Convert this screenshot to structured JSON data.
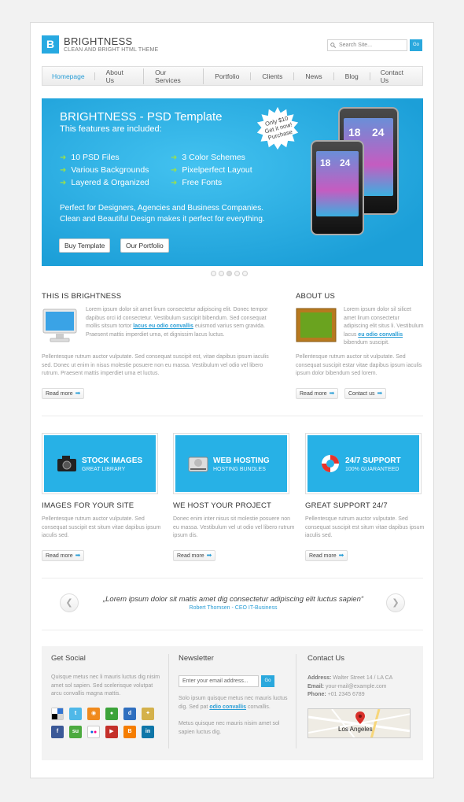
{
  "brand": {
    "logo_letter": "B",
    "title": "BRIGHTNESS",
    "subtitle": "CLEAN AND BRIGHT HTML THEME"
  },
  "search": {
    "placeholder": "Search Site...",
    "button": "Go"
  },
  "nav": [
    "Homepage",
    "About Us",
    "Our Services",
    "Portfolio",
    "Clients",
    "News",
    "Blog",
    "Contact Us"
  ],
  "slider": {
    "title": "BRIGHTNESS - PSD Template",
    "subtitle": "This features are included:",
    "features_left": [
      "10 PSD Files",
      "Various Backgrounds",
      "Layered & Organized"
    ],
    "features_right": [
      "3 Color Schemes",
      "Pixelperfect Layout",
      "Free Fonts"
    ],
    "desc1": "Perfect for Designers, Agencies and Business Companies.",
    "desc2": "Clean and Beautiful Design makes it perfect for everything.",
    "btn_buy": "Buy Template",
    "btn_portfolio": "Our Portfolio",
    "badge": [
      "Only $10",
      "Get it now!",
      "Purchase"
    ],
    "phone_time_a": "18",
    "phone_time_b": "24"
  },
  "intro": {
    "title": "THIS IS BRIGHTNESS",
    "p1a": "Lorem ipsum dolor sit amet lirum consectetur adipiscing elit. Donec tempor dapibus orci id consectetur. Vestibulum suscipit bibendum. Sed consequat mollis sitsum tortor",
    "p1link": "lacus eu odio convallis",
    "p1b": "euismod varius sem gravida. Praesent mattis imperdiet urna, et dignissim lacus luctus.",
    "p2": "Pellentesque rutrum auctor vulputate. Sed consequat suscipit est, vitae dapibus ipsum iaculis sed. Donec ut enim in nisus molestie posuere non eu massa. Vestibulum vel odio vel libero rutrum. Praesent mattis imperdiet urna et luctus.",
    "more": "Read more"
  },
  "about": {
    "title": "ABOUT US",
    "p1a": "Lorem ipsum dolor sil silicet amet lirum consectetur adipiscing elit situs li. Vestibulum lacus",
    "p1link": "eu odio convallis",
    "p1b": "bibendum suscipit.",
    "p2": "Pellentesque rutrum auctor sit vulputate. Sed consequat suscipit estar vitae dapibus ipsum iaculis ipsum dolor bibendum sed lorem.",
    "more": "Read more",
    "contact": "Contact us"
  },
  "boxes": [
    {
      "title": "STOCK IMAGES",
      "sub": "GREAT LIBRARY",
      "heading": "IMAGES FOR YOUR SITE",
      "text": "Pellentesque rutrum auctor vulputate. Sed consequat suscipit est situm vitae dapibus ipsum iaculis sed.",
      "more": "Read more"
    },
    {
      "title": "WEB HOSTING",
      "sub": "HOSTING BUNDLES",
      "heading": "WE HOST YOUR PROJECT",
      "text": "Donec enim inter nisus sit molestie posuere non eu massa. Vestibulum vel ut odio vel libero rutrum ipsum dis.",
      "more": "Read more"
    },
    {
      "title": "24/7 SUPPORT",
      "sub": "100% GUARANTEED",
      "heading": "GREAT SUPPORT 24/7",
      "text": "Pellentesque rutrum auctor vulputate. Sed consequat suscipit est situm vitae dapibus ipsum iaculis sed.",
      "more": "Read more"
    }
  ],
  "testimonial": {
    "quote": "„Lorem ipsum dolor sit matis amet dig consectetur adipiscing elit luctus sapien“",
    "author": "Robert Thomsen - CEO IT-Business"
  },
  "footer": {
    "social_title": "Get Social",
    "social_text": "Quisque metus nec li mauris luctus dig nisim amet sol sapien. Sed scelerisque volutpat arcu convallis magna mattis.",
    "social_icons": [
      "delicious",
      "twitter",
      "rss",
      "talk",
      "digg",
      "stumble",
      "facebook",
      "stumbleupon",
      "flickr",
      "youtube",
      "blogger",
      "linkedin"
    ],
    "newsletter_title": "Newsletter",
    "newsletter_placeholder": "Enter your email address...",
    "newsletter_btn": "Go",
    "newsletter_p1a": "Solo ipsum quisque metus nec mauris luctus dig. Sed pat",
    "newsletter_link": "odio convallis",
    "newsletter_p1b": "convallis.",
    "newsletter_p2": "Metus quisque nec mauris nisim amet sol sapien luctus dig.",
    "contact_title": "Contact Us",
    "address_label": "Address:",
    "address": "Walter Street 14 / LA CA",
    "email_label": "Email:",
    "email": "your-mail@example.com",
    "phone_label": "Phone:",
    "phone": "+01 2345 6789",
    "map_label": "Los Angeles"
  }
}
